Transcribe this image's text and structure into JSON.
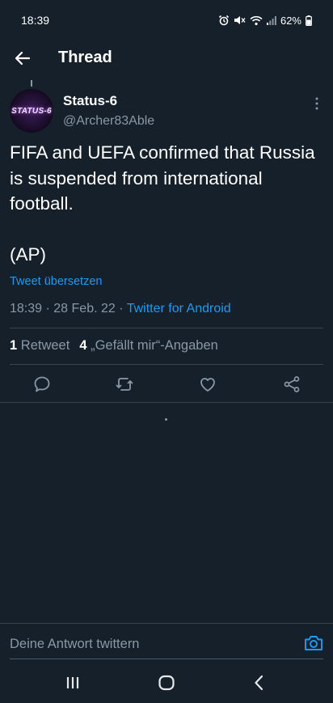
{
  "status_bar": {
    "time": "18:39",
    "battery": "62%",
    "icons": [
      "alarm-icon",
      "mute-icon",
      "wifi-icon",
      "signal-icon",
      "battery-icon"
    ]
  },
  "header": {
    "title": "Thread",
    "back_icon": "back-arrow-icon"
  },
  "tweet": {
    "avatar_text": "STATUS-6",
    "display_name": "Status-6",
    "handle": "@Archer83Able",
    "text": "FIFA and UEFA confirmed that Russia is suspended from international football.\n\n(AP)",
    "translate": "Tweet übersetzen",
    "time": "18:39",
    "date": "28 Feb. 22",
    "separator": "·",
    "source": "Twitter for Android",
    "retweet_count": "1",
    "retweet_label": "Retweet",
    "like_count": "4",
    "like_label": "„Gefällt mir“-Angaben"
  },
  "actions": [
    "reply-icon",
    "retweet-icon",
    "like-icon",
    "share-icon"
  ],
  "reply_bar": {
    "placeholder": "Deine Antwort twittern",
    "camera_icon": "camera-icon"
  },
  "colors": {
    "background": "#15202b",
    "accent": "#1d9bf0",
    "secondary_text": "#8899a6",
    "divider": "#38444d"
  }
}
